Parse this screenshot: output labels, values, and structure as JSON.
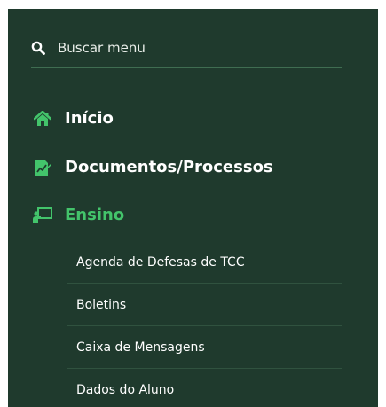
{
  "search": {
    "placeholder": "Buscar menu",
    "icon": "search-icon"
  },
  "nav": [
    {
      "label": "Início",
      "icon": "home-icon",
      "active": false
    },
    {
      "label": "Documentos/Processos",
      "icon": "document-chart-icon",
      "active": false
    },
    {
      "label": "Ensino",
      "icon": "teaching-board-icon",
      "active": true
    }
  ],
  "ensino_submenu": [
    {
      "label": "Agenda de Defesas de TCC"
    },
    {
      "label": "Boletins"
    },
    {
      "label": "Caixa de Mensagens"
    },
    {
      "label": "Dados do Aluno"
    }
  ],
  "colors": {
    "panel_bg": "#1f3a2d",
    "accent": "#43c46b",
    "text": "#ffffff"
  }
}
